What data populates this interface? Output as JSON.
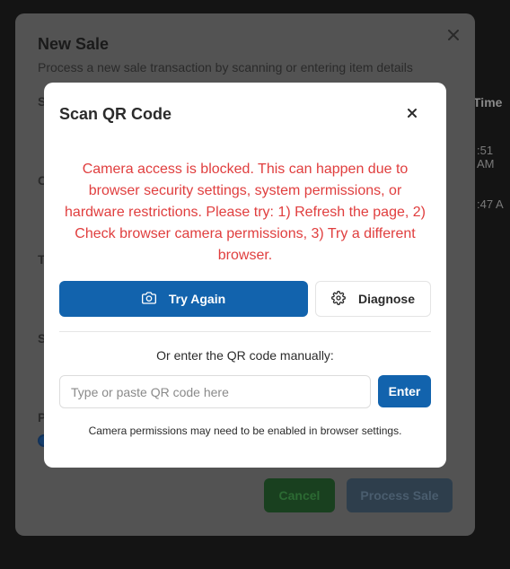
{
  "background_app": {
    "column_header": "Time",
    "cells": [
      ":51 AM",
      ":47 A"
    ]
  },
  "outer_dialog": {
    "title": "New Sale",
    "subtitle": "Process a new sale transaction by scanning or entering item details",
    "section_letters": [
      "S",
      "C",
      "T",
      "S",
      "P"
    ],
    "cancel_label": "Cancel",
    "process_label": "Process Sale"
  },
  "qr_modal": {
    "title": "Scan QR Code",
    "error_message": "Camera access is blocked. This can happen due to browser security settings, system permissions, or hardware restrictions. Please try: 1) Refresh the page, 2) Check browser camera permissions, 3) Try a different browser.",
    "try_again_label": "Try Again",
    "diagnose_label": "Diagnose",
    "manual_label": "Or enter the QR code manually:",
    "input_placeholder": "Type or paste QR code here",
    "input_value": "",
    "enter_label": "Enter",
    "hint": "Camera permissions may need to be enabled in browser settings."
  },
  "colors": {
    "primary": "#1263ad",
    "error": "#e03e3e",
    "overlay": "#0c0c0c"
  },
  "icons": {
    "close": "close-icon",
    "camera": "camera-icon",
    "settings": "gear-icon"
  }
}
